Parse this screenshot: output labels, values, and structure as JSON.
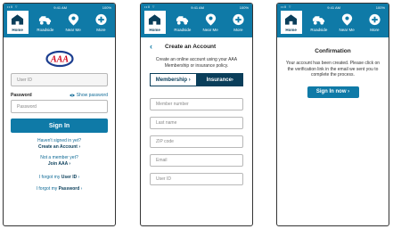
{
  "status": {
    "time": "9:41 AM",
    "battery": "100%",
    "carrier": "••ll ⌔"
  },
  "nav": {
    "home": "Home",
    "roadside": "Roadside",
    "near_me": "Near Me",
    "more": "More"
  },
  "login": {
    "user_id_placeholder": "User ID",
    "password_label": "Password",
    "show_password": "Show password",
    "password_placeholder": "Password",
    "sign_in": "Sign In",
    "not_signed_q": "Haven't signed in yet?",
    "create_account": "Create an Account ›",
    "not_member_q": "Not a member yet?",
    "join": "Join AAA ›",
    "forgot_user_prefix": "I forgot my ",
    "forgot_user_bold": "User ID",
    "forgot_user_suffix": " ›",
    "forgot_pwd_prefix": "I forgot my ",
    "forgot_pwd_bold": "Password",
    "forgot_pwd_suffix": " ›"
  },
  "create": {
    "back": "‹",
    "title": "Create an Account",
    "description": "Create an online account using your AAA Membership or insurance policy.",
    "tab_membership": "Membership ›",
    "tab_insurance": "Insurance›",
    "fields": [
      "Member number",
      "Last name",
      "ZIP code",
      "Email",
      "User ID"
    ]
  },
  "confirm": {
    "title": "Confirmation",
    "text": "Your account has been created. Please click on the verification link in the email we sent you to complete the process.",
    "button": "Sign In now ›"
  },
  "colors": {
    "primary": "#0f7aa7",
    "navy": "#0a3e5a",
    "logo_red": "#d0021b",
    "logo_blue": "#1b3d8f"
  },
  "icons": [
    "house-icon",
    "tow-truck-icon",
    "map-pin-icon",
    "plus-circle-icon",
    "eye-icon",
    "aaa-logo"
  ]
}
